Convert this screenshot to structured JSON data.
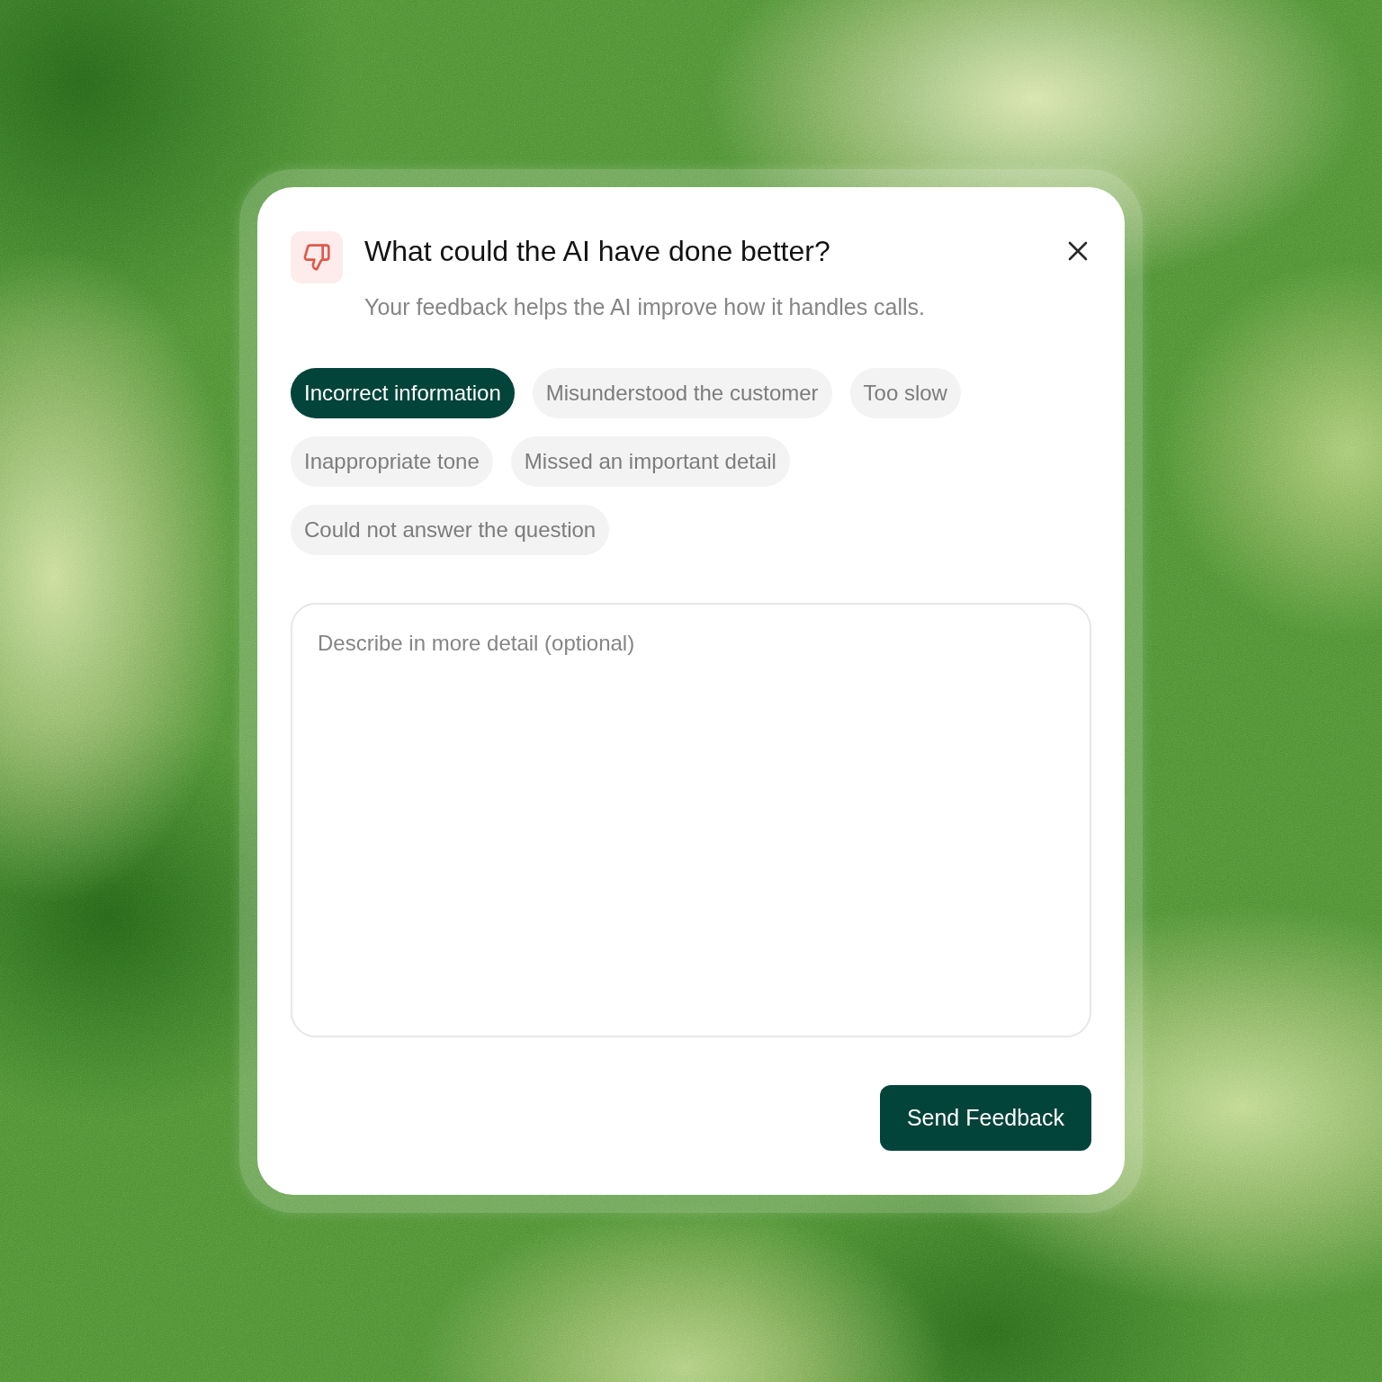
{
  "dialog": {
    "title": "What could the AI have done better?",
    "subtitle": "Your feedback helps the AI improve how it handles calls.",
    "reasons": [
      {
        "label": "Incorrect information",
        "selected": true
      },
      {
        "label": "Misunderstood the customer",
        "selected": false
      },
      {
        "label": "Too slow",
        "selected": false
      },
      {
        "label": "Inappropriate tone",
        "selected": false
      },
      {
        "label": "Missed an important detail",
        "selected": false
      },
      {
        "label": "Could not answer the question",
        "selected": false
      }
    ],
    "details": {
      "placeholder": "Describe in more detail (optional)"
    },
    "submit": "Send Feedback"
  }
}
